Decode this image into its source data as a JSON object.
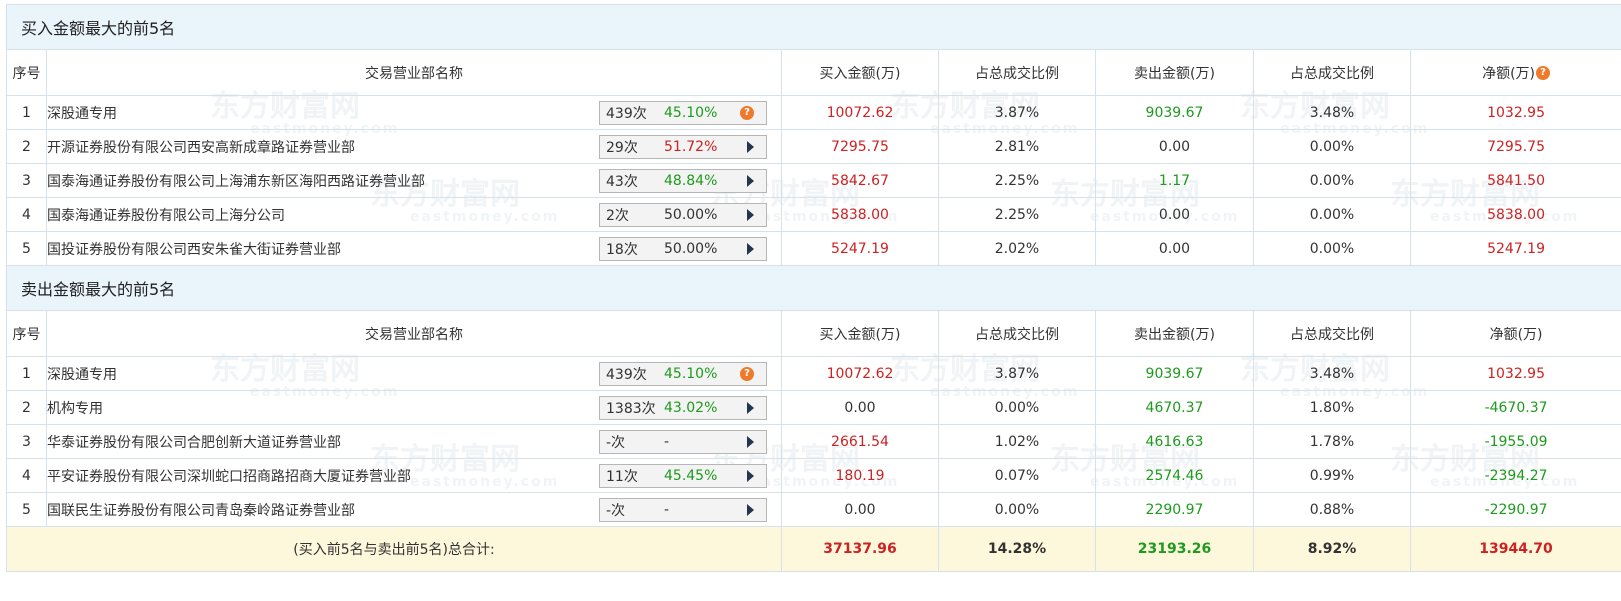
{
  "watermark": {
    "brand": "东方财富网",
    "domain": "eastmoney.com"
  },
  "buy_section": {
    "title": "买入金额最大的前5名",
    "headers": [
      "序号",
      "交易营业部名称",
      "买入金额(万)",
      "占总成交比例",
      "卖出金额(万)",
      "占总成交比例",
      "净额(万)"
    ],
    "rows": [
      {
        "idx": "1",
        "name": "深股通专用",
        "count": "439次",
        "pct": "45.10%",
        "pct_color": "green",
        "icon": "help-icon",
        "buy": "10072.62",
        "buy_pct": "3.87%",
        "sell": "9039.67",
        "sell_color": "green",
        "sell_pct": "3.48%",
        "net": "1032.95",
        "net_color": "red"
      },
      {
        "idx": "2",
        "name": "开源证券股份有限公司西安高新成章路证券营业部",
        "count": "29次",
        "pct": "51.72%",
        "pct_color": "red",
        "icon": "play-arrow-icon",
        "buy": "7295.75",
        "buy_pct": "2.81%",
        "sell": "0.00",
        "sell_color": "dark",
        "sell_pct": "0.00%",
        "net": "7295.75",
        "net_color": "red"
      },
      {
        "idx": "3",
        "name": "国泰海通证券股份有限公司上海浦东新区海阳西路证券营业部",
        "count": "43次",
        "pct": "48.84%",
        "pct_color": "green",
        "icon": "play-arrow-icon",
        "buy": "5842.67",
        "buy_pct": "2.25%",
        "sell": "1.17",
        "sell_color": "green",
        "sell_pct": "0.00%",
        "net": "5841.50",
        "net_color": "red"
      },
      {
        "idx": "4",
        "name": "国泰海通证券股份有限公司上海分公司",
        "count": "2次",
        "pct": "50.00%",
        "pct_color": "dark",
        "icon": "play-arrow-icon",
        "buy": "5838.00",
        "buy_pct": "2.25%",
        "sell": "0.00",
        "sell_color": "dark",
        "sell_pct": "0.00%",
        "net": "5838.00",
        "net_color": "red"
      },
      {
        "idx": "5",
        "name": "国投证券股份有限公司西安朱雀大街证券营业部",
        "count": "18次",
        "pct": "50.00%",
        "pct_color": "dark",
        "icon": "play-arrow-icon",
        "buy": "5247.19",
        "buy_pct": "2.02%",
        "sell": "0.00",
        "sell_color": "dark",
        "sell_pct": "0.00%",
        "net": "5247.19",
        "net_color": "red"
      }
    ]
  },
  "sell_section": {
    "title": "卖出金额最大的前5名",
    "headers": [
      "序号",
      "交易营业部名称",
      "买入金额(万)",
      "占总成交比例",
      "卖出金额(万)",
      "占总成交比例",
      "净额(万)"
    ],
    "rows": [
      {
        "idx": "1",
        "name": "深股通专用",
        "count": "439次",
        "pct": "45.10%",
        "pct_color": "green",
        "icon": "help-icon",
        "buy": "10072.62",
        "buy_color": "red",
        "buy_pct": "3.87%",
        "sell": "9039.67",
        "sell_pct": "3.48%",
        "net": "1032.95",
        "net_color": "red"
      },
      {
        "idx": "2",
        "name": "机构专用",
        "count": "1383次",
        "pct": "43.02%",
        "pct_color": "green",
        "icon": "play-arrow-icon",
        "buy": "0.00",
        "buy_color": "dark",
        "buy_pct": "0.00%",
        "sell": "4670.37",
        "sell_pct": "1.80%",
        "net": "-4670.37",
        "net_color": "green"
      },
      {
        "idx": "3",
        "name": "华泰证券股份有限公司合肥创新大道证券营业部",
        "count": "-次",
        "pct": "-",
        "pct_color": "dark",
        "icon": "play-arrow-icon",
        "buy": "2661.54",
        "buy_color": "red",
        "buy_pct": "1.02%",
        "sell": "4616.63",
        "sell_pct": "1.78%",
        "net": "-1955.09",
        "net_color": "green"
      },
      {
        "idx": "4",
        "name": "平安证券股份有限公司深圳蛇口招商路招商大厦证券营业部",
        "count": "11次",
        "pct": "45.45%",
        "pct_color": "green",
        "icon": "play-arrow-icon",
        "buy": "180.19",
        "buy_color": "red",
        "buy_pct": "0.07%",
        "sell": "2574.46",
        "sell_pct": "0.99%",
        "net": "-2394.27",
        "net_color": "green"
      },
      {
        "idx": "5",
        "name": "国联民生证券股份有限公司青岛秦岭路证券营业部",
        "count": "-次",
        "pct": "-",
        "pct_color": "dark",
        "icon": "play-arrow-icon",
        "buy": "0.00",
        "buy_color": "dark",
        "buy_pct": "0.00%",
        "sell": "2290.97",
        "sell_pct": "0.88%",
        "net": "-2290.97",
        "net_color": "green"
      }
    ]
  },
  "total": {
    "label": "(买入前5名与卖出前5名)总合计:",
    "buy": "37137.96",
    "buy_pct": "14.28%",
    "sell": "23193.26",
    "sell_pct": "8.92%",
    "net": "13944.70"
  },
  "colors": {
    "red": "#cc2222",
    "green": "#1e9a1e",
    "header_bg": "#eaf4fb",
    "total_bg": "#fdf8dc",
    "border": "#d6e1ea",
    "help_icon": "#f07a2b"
  }
}
